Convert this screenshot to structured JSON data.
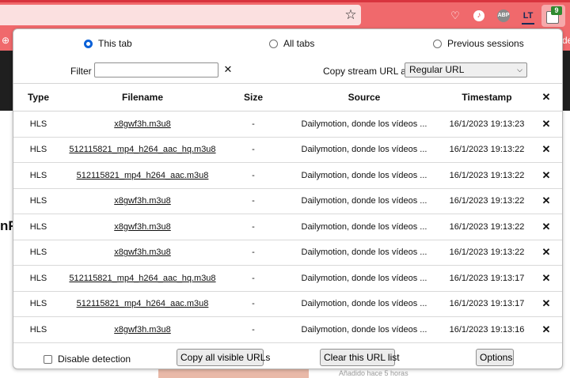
{
  "browser": {
    "extensions": {
      "badge_count": "9",
      "lt_label": "LT",
      "abp_label": "ABP"
    },
    "bookmark_tail": "de"
  },
  "page": {
    "side_text": "nFi",
    "added_text": "Añadido hace 5 horas"
  },
  "popup": {
    "tabs": [
      {
        "label": "This tab",
        "selected": true
      },
      {
        "label": "All tabs",
        "selected": false
      },
      {
        "label": "Previous sessions",
        "selected": false
      }
    ],
    "filter": {
      "label": "Filter",
      "value": "",
      "clear": "✕"
    },
    "copy_stream": {
      "label": "Copy stream URL as",
      "selected": "Regular URL"
    },
    "columns": {
      "type": "Type",
      "filename": "Filename",
      "size": "Size",
      "source": "Source",
      "timestamp": "Timestamp",
      "clear_all": "✕"
    },
    "rows": [
      {
        "type": "HLS",
        "filename": "x8gwf3h.m3u8",
        "size": "-",
        "source": "Dailymotion, donde los vídeos ...",
        "timestamp": "16/1/2023 19:13:23"
      },
      {
        "type": "HLS",
        "filename": "512115821_mp4_h264_aac_hq.m3u8",
        "size": "-",
        "source": "Dailymotion, donde los vídeos ...",
        "timestamp": "16/1/2023 19:13:22"
      },
      {
        "type": "HLS",
        "filename": "512115821_mp4_h264_aac.m3u8",
        "size": "-",
        "source": "Dailymotion, donde los vídeos ...",
        "timestamp": "16/1/2023 19:13:22"
      },
      {
        "type": "HLS",
        "filename": "x8gwf3h.m3u8",
        "size": "-",
        "source": "Dailymotion, donde los vídeos ...",
        "timestamp": "16/1/2023 19:13:22"
      },
      {
        "type": "HLS",
        "filename": "x8gwf3h.m3u8",
        "size": "-",
        "source": "Dailymotion, donde los vídeos ...",
        "timestamp": "16/1/2023 19:13:22"
      },
      {
        "type": "HLS",
        "filename": "x8gwf3h.m3u8",
        "size": "-",
        "source": "Dailymotion, donde los vídeos ...",
        "timestamp": "16/1/2023 19:13:22"
      },
      {
        "type": "HLS",
        "filename": "512115821_mp4_h264_aac_hq.m3u8",
        "size": "-",
        "source": "Dailymotion, donde los vídeos ...",
        "timestamp": "16/1/2023 19:13:17"
      },
      {
        "type": "HLS",
        "filename": "512115821_mp4_h264_aac.m3u8",
        "size": "-",
        "source": "Dailymotion, donde los vídeos ...",
        "timestamp": "16/1/2023 19:13:17"
      },
      {
        "type": "HLS",
        "filename": "x8gwf3h.m3u8",
        "size": "-",
        "source": "Dailymotion, donde los vídeos ...",
        "timestamp": "16/1/2023 19:13:16"
      }
    ],
    "row_remove": "✕",
    "footer": {
      "disable_detection": "Disable detection",
      "copy_all": "Copy all visible URLs",
      "clear_list": "Clear this URL list",
      "options": "Options"
    }
  }
}
